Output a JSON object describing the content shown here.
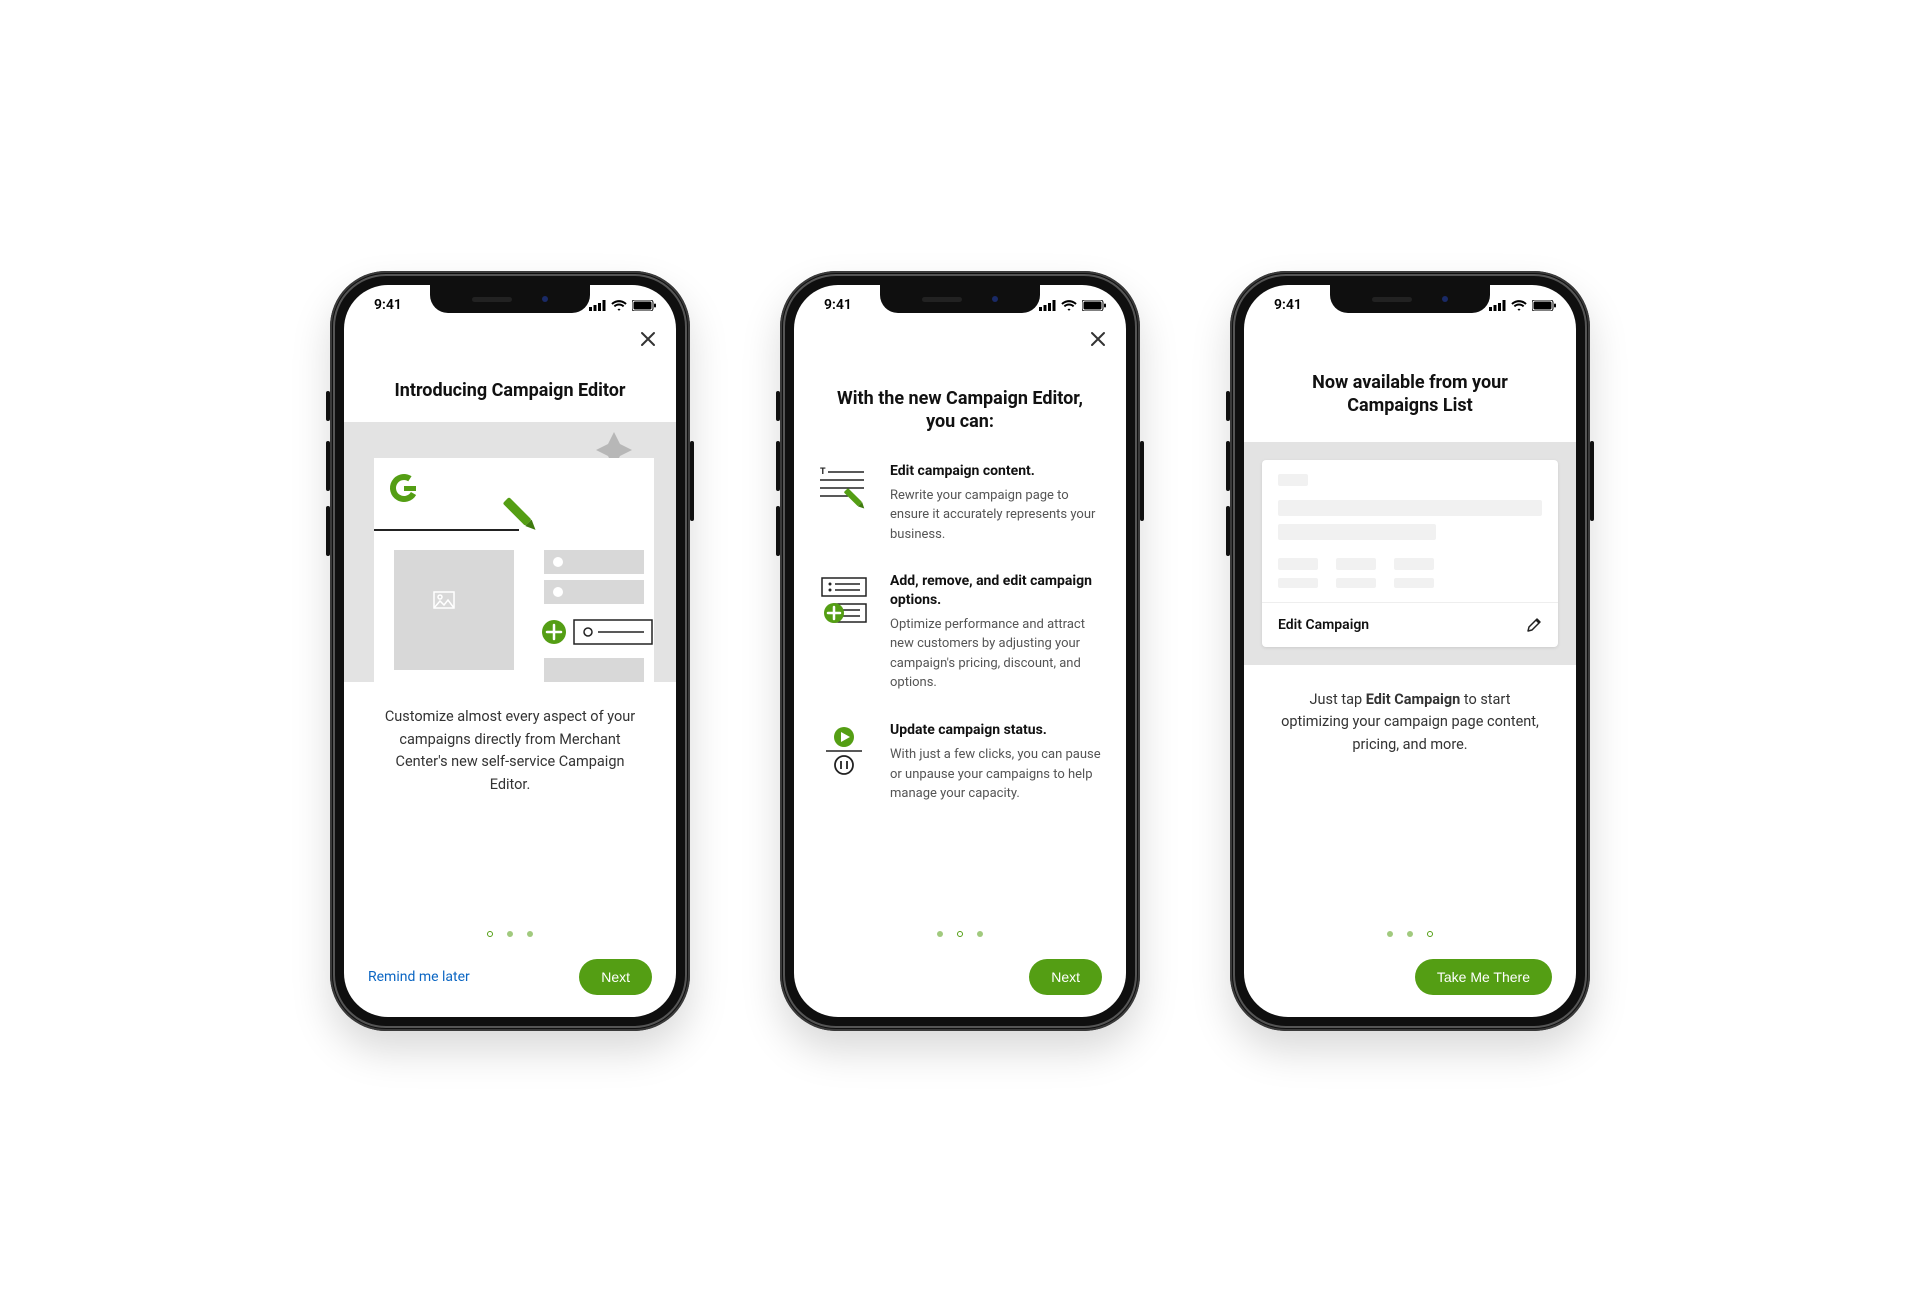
{
  "status": {
    "time": "9:41"
  },
  "colors": {
    "accent": "#549e14",
    "link": "#0b66c3"
  },
  "screen1": {
    "title": "Introducing Campaign Editor",
    "body": "Customize almost every aspect of your campaigns directly from Merchant Center's new self-service Campaign Editor.",
    "remind": "Remind me later",
    "next": "Next",
    "active_dot": 0
  },
  "screen2": {
    "title": "With the new Campaign Editor, you can:",
    "features": [
      {
        "heading": "Edit campaign content.",
        "body": "Rewrite your campaign page to ensure it accurately represents your business."
      },
      {
        "heading": "Add, remove, and edit campaign options.",
        "body": "Optimize performance and attract new customers by adjusting your campaign's pricing, discount, and options."
      },
      {
        "heading": "Update campaign status.",
        "body": "With just a few clicks, you can pause or unpause your campaigns to help manage your capacity."
      }
    ],
    "next": "Next",
    "active_dot": 1
  },
  "screen3": {
    "title": "Now available from your Campaigns List",
    "edit_label": "Edit Campaign",
    "body_prefix": "Just tap ",
    "body_bold": "Edit Campaign",
    "body_suffix": " to start optimizing your campaign page content, pricing, and more.",
    "cta": "Take Me There",
    "active_dot": 2
  }
}
